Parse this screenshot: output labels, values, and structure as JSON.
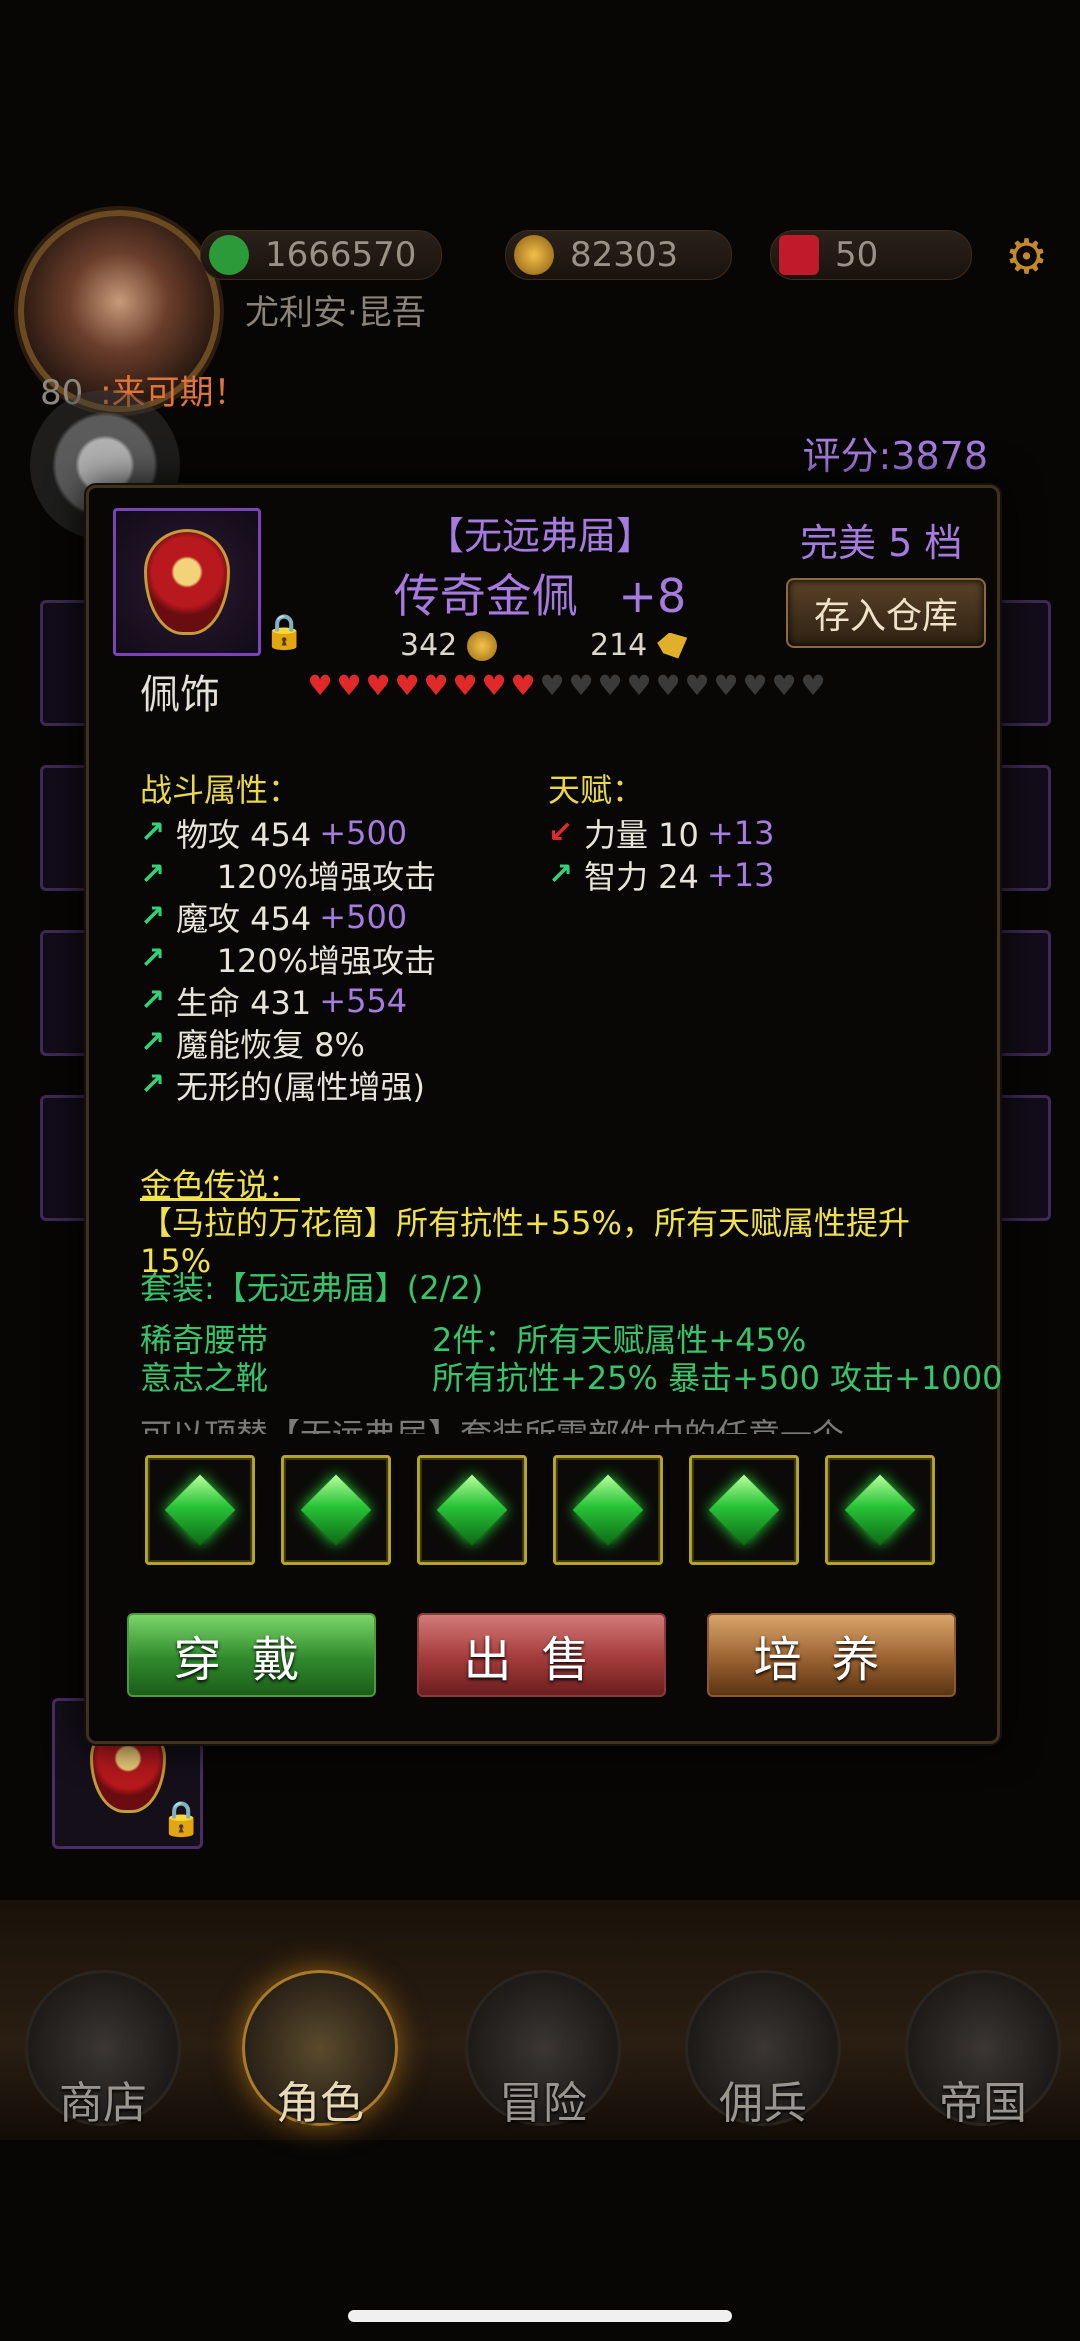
{
  "hud": {
    "gold_value": "1666570",
    "coin_value": "82303",
    "gem_value": "50",
    "player_name": "尤利安·昆吾",
    "level": "80",
    "banner_text": ":来可期！",
    "score": "评分:3878"
  },
  "item": {
    "set_name": "【无远弗届】",
    "name": "传奇金佩",
    "enhance": "+8",
    "quality": "完美 5 档",
    "store_button": "存入仓库",
    "slot": "佩饰",
    "price_coin": "342",
    "price_shard": "214",
    "hearts_filled": 8,
    "hearts_total": 18
  },
  "combat": {
    "heading": "战斗属性：",
    "stats": [
      {
        "arrow": "up",
        "label": "物攻 454",
        "bonus": "+500"
      },
      {
        "arrow": "up",
        "label": "    120%增强攻击",
        "bonus": ""
      },
      {
        "arrow": "up",
        "label": "魔攻 454",
        "bonus": "+500"
      },
      {
        "arrow": "up",
        "label": "    120%增强攻击",
        "bonus": ""
      },
      {
        "arrow": "up",
        "label": "生命 431",
        "bonus": "+554"
      },
      {
        "arrow": "up",
        "label": "魔能恢复 8%",
        "bonus": ""
      },
      {
        "arrow": "up",
        "label": "无形的(属性增强)",
        "bonus": ""
      }
    ]
  },
  "talent": {
    "heading": "天赋：",
    "stats": [
      {
        "arrow": "down",
        "label": "力量 10",
        "bonus": "+13"
      },
      {
        "arrow": "up",
        "label": "智力 24",
        "bonus": "+13"
      }
    ]
  },
  "legend": {
    "heading": "金色传说：",
    "text": "【马拉的万花筒】所有抗性+55%，所有天赋属性提升15%"
  },
  "set": {
    "title": "套装:【无远弗届】(2/2)",
    "piece1": "稀奇腰带",
    "piece2": "意志之靴",
    "bonus1": "2件：所有天赋属性+45%",
    "bonus2": "所有抗性+25% 暴击+500 攻击+1000",
    "cut_text": "可以顶替【无远弗届】套装所需部件中的任意一个"
  },
  "gems": [
    "green",
    "green",
    "green",
    "green",
    "green",
    "green"
  ],
  "actions": {
    "equip": "穿戴",
    "sell": "出售",
    "train": "培养"
  },
  "nav": [
    "商店",
    "角色",
    "冒险",
    "佣兵",
    "帝国"
  ],
  "colors": {
    "purple": "#a67bdf",
    "yellow": "#e8d84a",
    "green": "#39c46a",
    "red": "#e02a2a"
  }
}
